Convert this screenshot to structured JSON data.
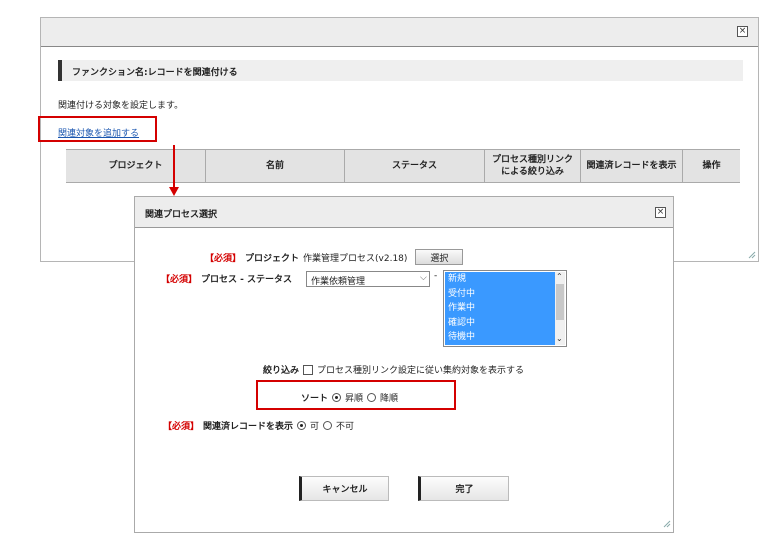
{
  "background_dialog": {
    "function_title": "ファンクション名:レコードを関連付ける",
    "description": "関連付ける対象を設定します。",
    "add_link": "関連対象を追加する",
    "columns": [
      "プロジェクト",
      "名前",
      "ステータス",
      "プロセス種別リンクによる絞り込み",
      "関連済レコードを表示",
      "操作"
    ]
  },
  "dialog": {
    "title": "関連プロセス選択",
    "required_tag": "【必須】",
    "project_label": "プロジェクト",
    "project_value": "作業管理プロセス(v2.18)",
    "select_button": "選択",
    "process_status_label": "プロセス - ステータス",
    "process_value": "作業依頼管理",
    "separator": "-",
    "status_options": [
      "新規",
      "受付中",
      "作業中",
      "確認中",
      "待機中"
    ],
    "filter_label": "絞り込み",
    "filter_option": "プロセス種別リンク設定に従い集約対象を表示する",
    "sort_label": "ソート",
    "sort_options": [
      "昇順",
      "降順"
    ],
    "sort_selected": "昇順",
    "display_related_label": "関連済レコードを表示",
    "display_options": [
      "可",
      "不可"
    ],
    "display_selected": "可",
    "cancel_button": "キャンセル",
    "done_button": "完了"
  },
  "colors": {
    "highlight": "#d40000",
    "selection": "#3a99ff",
    "link": "#1a56b0"
  }
}
